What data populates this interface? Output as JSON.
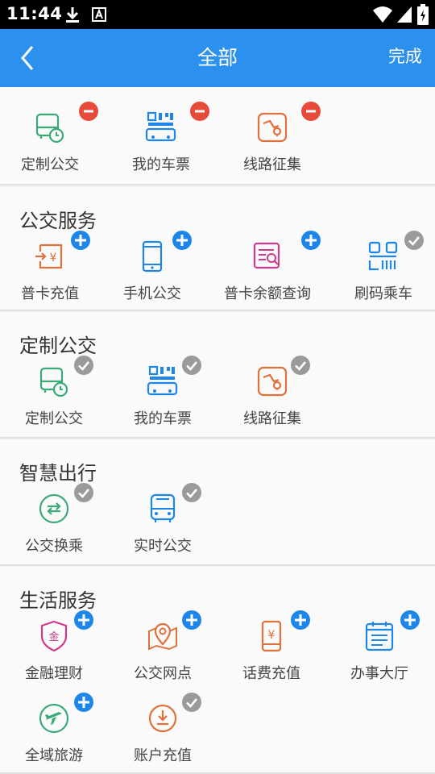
{
  "status_bar": {
    "time": "11:44"
  },
  "header": {
    "title": "全部",
    "done_label": "完成"
  },
  "my_apps": {
    "items": [
      {
        "label": "定制公交",
        "icon": "custom-bus-icon",
        "badge": "remove"
      },
      {
        "label": "我的车票",
        "icon": "ticket-qr-icon",
        "badge": "remove"
      },
      {
        "label": "线路征集",
        "icon": "route-map-icon",
        "badge": "remove"
      }
    ]
  },
  "sections": [
    {
      "title": "公交服务",
      "items": [
        {
          "label": "普卡充值",
          "icon": "card-recharge-icon",
          "badge": "add"
        },
        {
          "label": "手机公交",
          "icon": "mobile-icon",
          "badge": "add"
        },
        {
          "label": "普卡余额查询",
          "icon": "balance-query-icon",
          "badge": "add"
        },
        {
          "label": "刷码乘车",
          "icon": "scan-code-icon",
          "badge": "added"
        }
      ]
    },
    {
      "title": "定制公交",
      "items": [
        {
          "label": "定制公交",
          "icon": "custom-bus-icon",
          "badge": "added"
        },
        {
          "label": "我的车票",
          "icon": "ticket-qr-icon",
          "badge": "added"
        },
        {
          "label": "线路征集",
          "icon": "route-map-icon",
          "badge": "added"
        }
      ]
    },
    {
      "title": "智慧出行",
      "items": [
        {
          "label": "公交换乘",
          "icon": "transfer-icon",
          "badge": "added"
        },
        {
          "label": "实时公交",
          "icon": "realtime-bus-icon",
          "badge": "added"
        }
      ]
    },
    {
      "title": "生活服务",
      "items": [
        {
          "label": "金融理财",
          "icon": "finance-shield-icon",
          "badge": "add"
        },
        {
          "label": "公交网点",
          "icon": "map-pin-icon",
          "badge": "add"
        },
        {
          "label": "话费充值",
          "icon": "phone-bill-icon",
          "badge": "add"
        },
        {
          "label": "办事大厅",
          "icon": "service-hall-icon",
          "badge": "add"
        },
        {
          "label": "全域旅游",
          "icon": "travel-plane-icon",
          "badge": "add"
        },
        {
          "label": "账户充值",
          "icon": "account-recharge-icon",
          "badge": "added"
        }
      ]
    }
  ],
  "colors": {
    "header": "#2c90ee",
    "remove": "#e84a3a",
    "add": "#1d86e8",
    "added": "#9a9a9a"
  }
}
